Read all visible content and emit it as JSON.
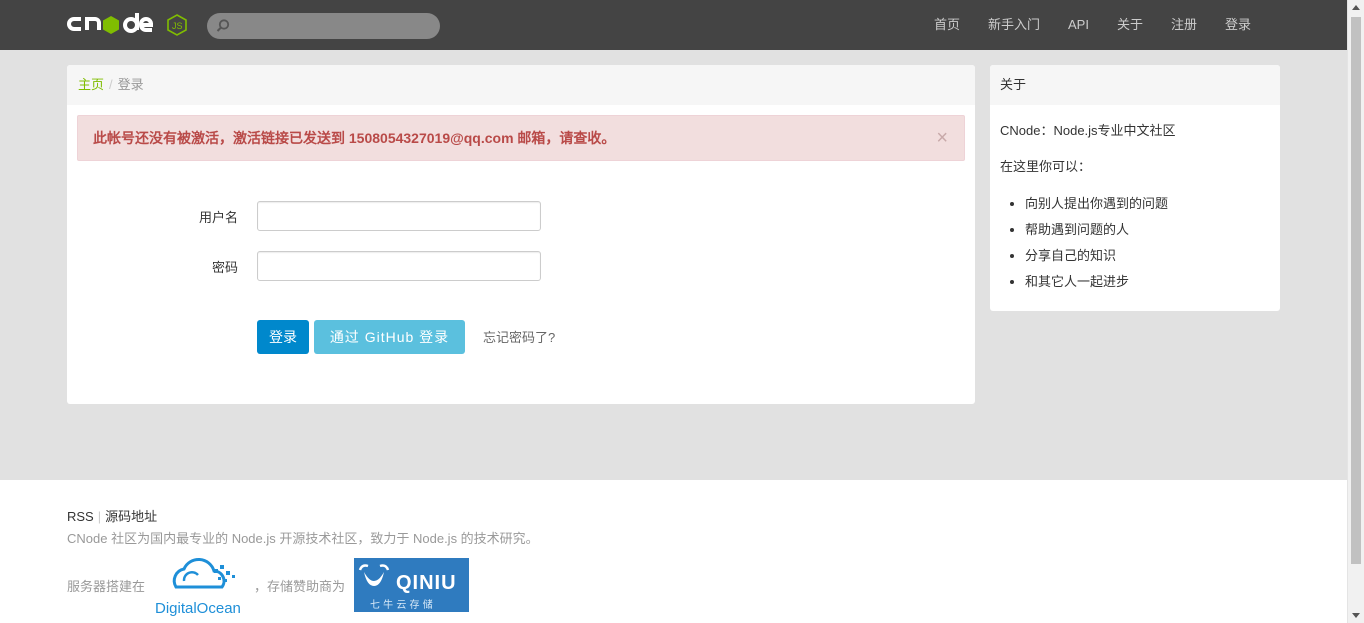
{
  "navbar": {
    "brand": "cnode js",
    "search": {
      "value": "",
      "placeholder": ""
    },
    "links": [
      {
        "label": "首页"
      },
      {
        "label": "新手入门"
      },
      {
        "label": "API"
      },
      {
        "label": "关于"
      },
      {
        "label": "注册"
      },
      {
        "label": "登录"
      }
    ]
  },
  "breadcrumb": {
    "home": "主页",
    "separator": "/",
    "current": "登录"
  },
  "alert": {
    "message": "此帐号还没有被激活，激活链接已发送到 1508054327019@qq.com 邮箱，请查收。",
    "close": "×"
  },
  "form": {
    "username_label": "用户名",
    "username_value": "",
    "password_label": "密码",
    "password_value": "",
    "login_button": "登录",
    "github_button": "通过 GitHub 登录",
    "forgot_link": "忘记密码了?"
  },
  "sidebar": {
    "title": "关于",
    "intro": "CNode：Node.js专业中文社区",
    "subtitle": "在这里你可以：",
    "items": [
      "向别人提出你遇到的问题",
      "帮助遇到问题的人",
      "分享自己的知识",
      "和其它人一起进步"
    ]
  },
  "footer": {
    "rss": "RSS",
    "separator": "|",
    "source": "源码地址",
    "description": "CNode 社区为国内最专业的 Node.js 开源技术社区，致力于 Node.js 的技术研究。",
    "server_text": "服务器搭建在",
    "storage_text": "，存储赞助商为",
    "digitalocean": "DigitalOcean",
    "qiniu": "QINIU",
    "qiniu_sub": "七 牛 云 存 储"
  },
  "colors": {
    "navbar_bg": "#444444",
    "accent_green": "#80bd01",
    "login_button": "#0088cc",
    "github_button": "#5bc0de",
    "alert_bg": "#f2dede",
    "alert_text": "#b94a48"
  }
}
